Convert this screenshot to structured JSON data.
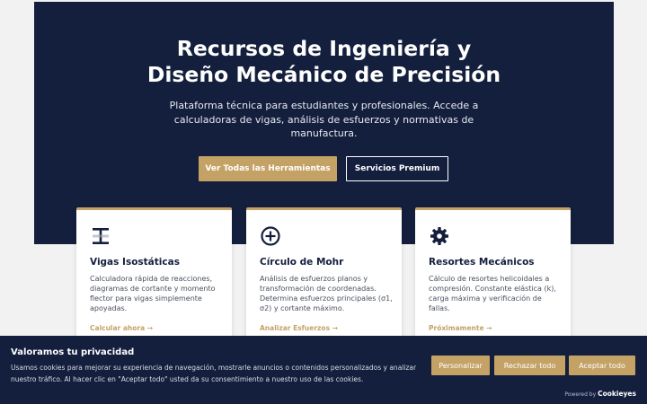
{
  "hero": {
    "title_line1": "Recursos de Ingeniería y",
    "title_line2": "Diseño Mecánico de Precisión",
    "subtitle": "Plataforma técnica para estudiantes y profesionales. Accede a calculadoras de vigas, análisis de esfuerzos y normativas de manufactura.",
    "primary_button": "Ver Todas las Herramientas",
    "secondary_button": "Servicios Premium"
  },
  "cards": [
    {
      "icon": "beam-icon",
      "title": "Vigas Isostáticas",
      "description": "Calculadora rápida de reacciones, diagramas de cortante y momento flector para vigas simplemente apoyadas.",
      "link": "Calcular ahora →"
    },
    {
      "icon": "plus-circle-icon",
      "title": "Círculo de Mohr",
      "description": "Análisis de esfuerzos planos y transformación de coordenadas. Determina esfuerzos principales (σ1, σ2) y cortante máximo.",
      "link": "Analizar Esfuerzos →"
    },
    {
      "icon": "gear-icon",
      "title": "Resortes Mecánicos",
      "description": "Cálculo de resortes helicoidales a compresión. Constante elástica (k), carga máxima y verificación de fallas.",
      "link": "Próximamente →"
    }
  ],
  "cookie_banner": {
    "title": "Valoramos tu privacidad",
    "text": "Usamos cookies para mejorar su experiencia de navegación, mostrarle anuncios o contenidos personalizados y analizar nuestro tráfico. Al hacer clic en \"Aceptar todo\" usted da su consentimiento a nuestro uso de las cookies.",
    "customize": "Personalizar",
    "reject": "Rechazar todo",
    "accept": "Aceptar todo",
    "powered_by": "Powered by",
    "brand": "Cookieyes"
  },
  "colors": {
    "navy": "#141f3d",
    "gold": "#c4a266",
    "background": "#f2f2f2"
  }
}
